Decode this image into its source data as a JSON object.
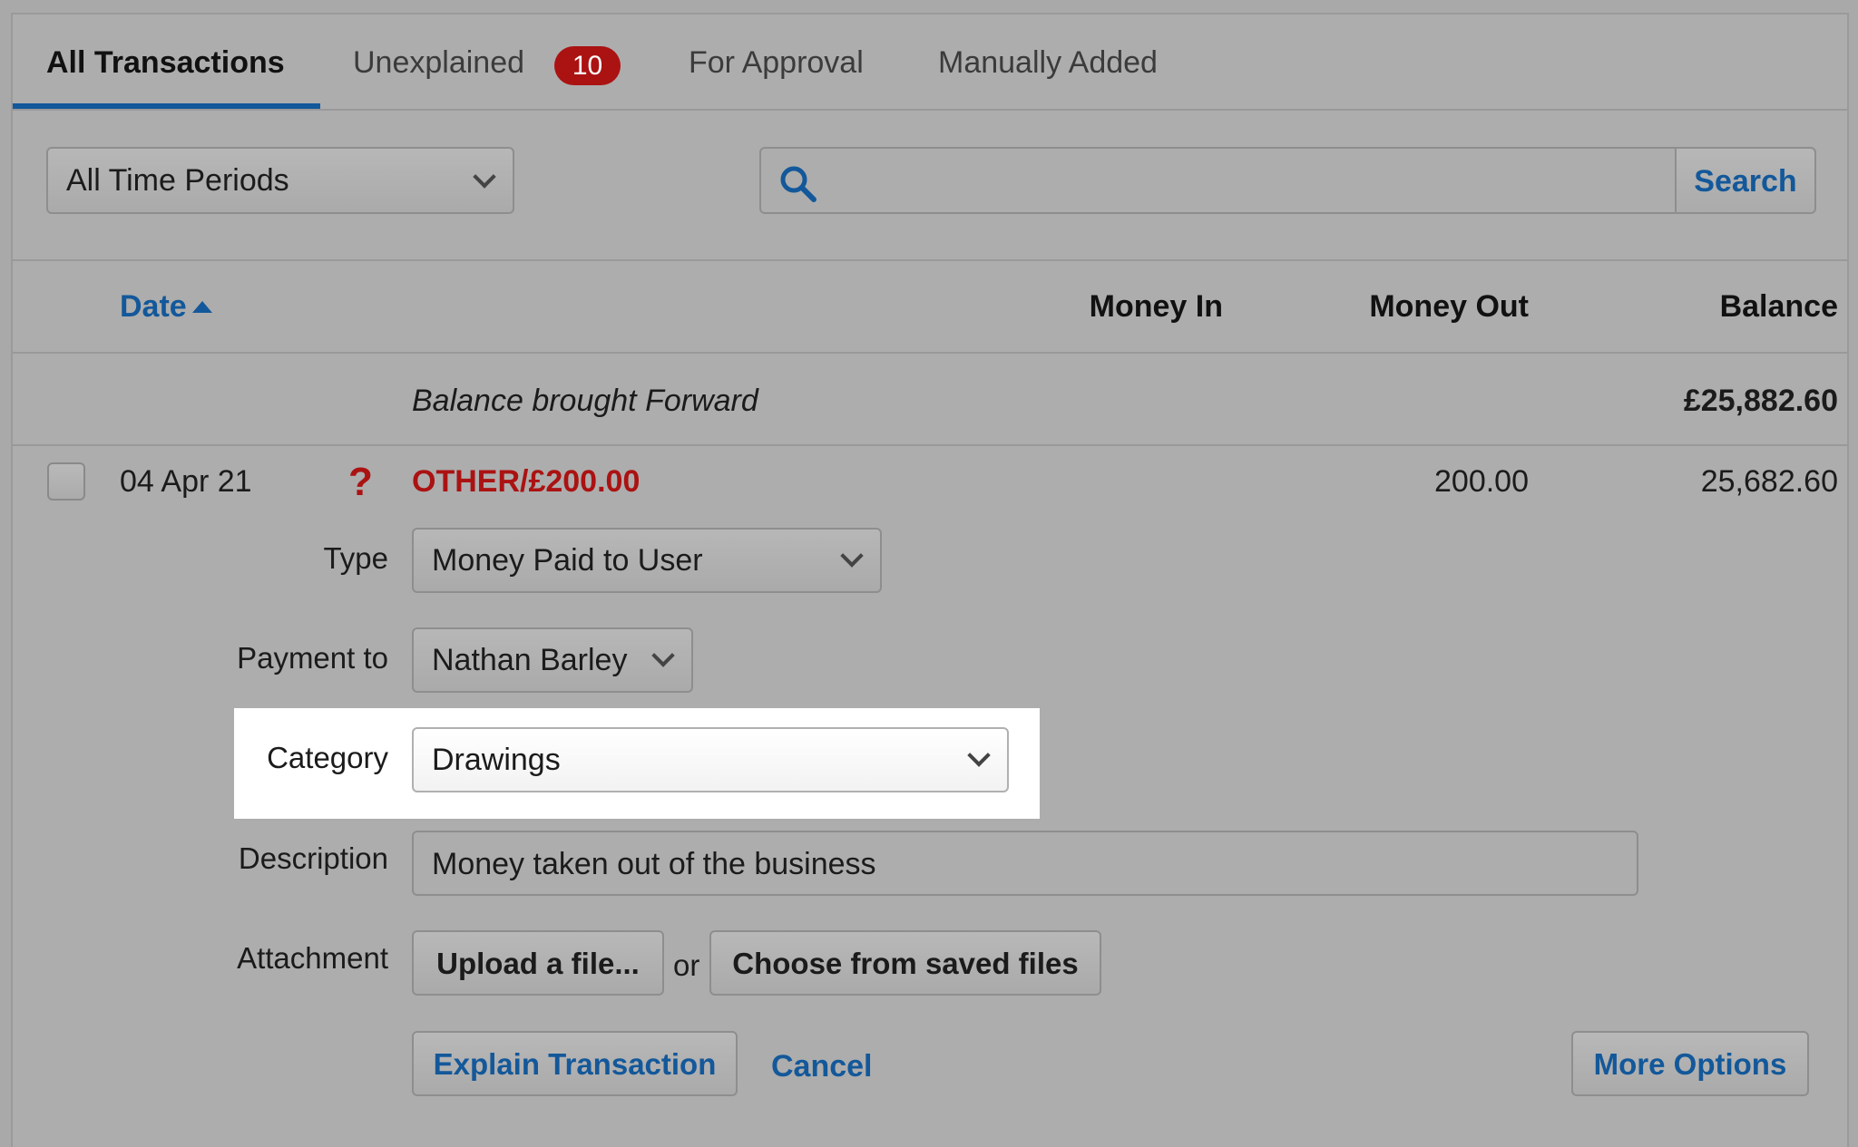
{
  "tabs": [
    {
      "label": "All Transactions",
      "active": true
    },
    {
      "label": "Unexplained",
      "badge": "10"
    },
    {
      "label": "For Approval"
    },
    {
      "label": "Manually Added"
    }
  ],
  "filters": {
    "period_select": "All Time Periods",
    "search_placeholder": "",
    "search_button": "Search"
  },
  "table": {
    "columns": [
      "Date",
      "Money In",
      "Money Out",
      "Balance"
    ],
    "sort": "ascending"
  },
  "balance_forward": {
    "label": "Balance brought Forward",
    "amount": "£25,882.60"
  },
  "transaction": {
    "date": "04 Apr 21",
    "status_icon": "?",
    "name": "OTHER/£200.00",
    "money_out": "200.00",
    "balance": "25,682.60"
  },
  "form": {
    "type_label": "Type",
    "type_value": "Money Paid to User",
    "payment_label": "Payment to",
    "payment_value": "Nathan Barley",
    "category_label": "Category",
    "category_value": "Drawings",
    "description_label": "Description",
    "description_value": "Money taken out of the business",
    "attachment_label": "Attachment",
    "upload_button": "Upload a file...",
    "or_text": "or",
    "saved_files_button": "Choose from saved files"
  },
  "actions": {
    "explain": "Explain Transaction",
    "cancel": "Cancel",
    "more_options": "More Options"
  },
  "colors": {
    "accent": "#13589a",
    "alert": "#ab1212",
    "background": "#adadad"
  }
}
